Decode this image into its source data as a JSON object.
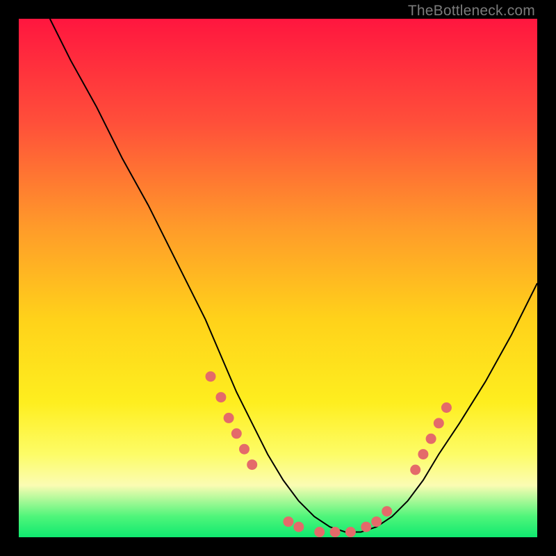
{
  "watermark": "TheBottleneck.com",
  "colors": {
    "frame": "#000000",
    "gradient_top": "#ff163f",
    "gradient_bottom": "#0fe96f",
    "line": "#000000",
    "marker": "#e46a6a"
  },
  "chart_data": {
    "type": "line",
    "title": "",
    "xlabel": "",
    "ylabel": "",
    "xlim": [
      0,
      100
    ],
    "ylim": [
      0,
      100
    ],
    "series": [
      {
        "name": "curve",
        "x": [
          6,
          10,
          15,
          20,
          25,
          30,
          33,
          36,
          39,
          42,
          45,
          48,
          51,
          54,
          57,
          60,
          63,
          66,
          69,
          72,
          75,
          78,
          81,
          85,
          90,
          95,
          100
        ],
        "values": [
          100,
          92,
          83,
          73,
          64,
          54,
          48,
          42,
          35,
          28,
          22,
          16,
          11,
          7,
          4,
          2,
          1,
          1,
          2,
          4,
          7,
          11,
          16,
          22,
          30,
          39,
          49
        ]
      }
    ],
    "markers": [
      {
        "x": 37,
        "y": 31
      },
      {
        "x": 39,
        "y": 27
      },
      {
        "x": 40.5,
        "y": 23
      },
      {
        "x": 42,
        "y": 20
      },
      {
        "x": 43.5,
        "y": 17
      },
      {
        "x": 45,
        "y": 14
      },
      {
        "x": 52,
        "y": 3
      },
      {
        "x": 54,
        "y": 2
      },
      {
        "x": 58,
        "y": 1
      },
      {
        "x": 61,
        "y": 1
      },
      {
        "x": 64,
        "y": 1
      },
      {
        "x": 67,
        "y": 2
      },
      {
        "x": 69,
        "y": 3
      },
      {
        "x": 71,
        "y": 5
      },
      {
        "x": 76.5,
        "y": 13
      },
      {
        "x": 78,
        "y": 16
      },
      {
        "x": 79.5,
        "y": 19
      },
      {
        "x": 81,
        "y": 22
      },
      {
        "x": 82.5,
        "y": 25
      }
    ]
  }
}
